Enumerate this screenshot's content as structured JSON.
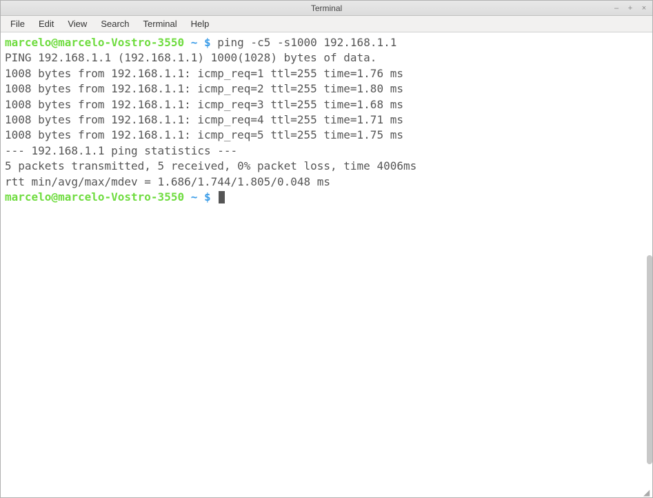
{
  "window": {
    "title": "Terminal"
  },
  "menubar": {
    "items": [
      "File",
      "Edit",
      "View",
      "Search",
      "Terminal",
      "Help"
    ]
  },
  "terminal": {
    "prompt_user": "marcelo@marcelo-Vostro-3550",
    "prompt_path": " ~ $ ",
    "command": "ping -c5 -s1000 192.168.1.1",
    "output": [
      "PING 192.168.1.1 (192.168.1.1) 1000(1028) bytes of data.",
      "1008 bytes from 192.168.1.1: icmp_req=1 ttl=255 time=1.76 ms",
      "1008 bytes from 192.168.1.1: icmp_req=2 ttl=255 time=1.80 ms",
      "1008 bytes from 192.168.1.1: icmp_req=3 ttl=255 time=1.68 ms",
      "1008 bytes from 192.168.1.1: icmp_req=4 ttl=255 time=1.71 ms",
      "1008 bytes from 192.168.1.1: icmp_req=5 ttl=255 time=1.75 ms",
      "",
      "--- 192.168.1.1 ping statistics ---",
      "5 packets transmitted, 5 received, 0% packet loss, time 4006ms",
      "rtt min/avg/max/mdev = 1.686/1.744/1.805/0.048 ms"
    ]
  }
}
